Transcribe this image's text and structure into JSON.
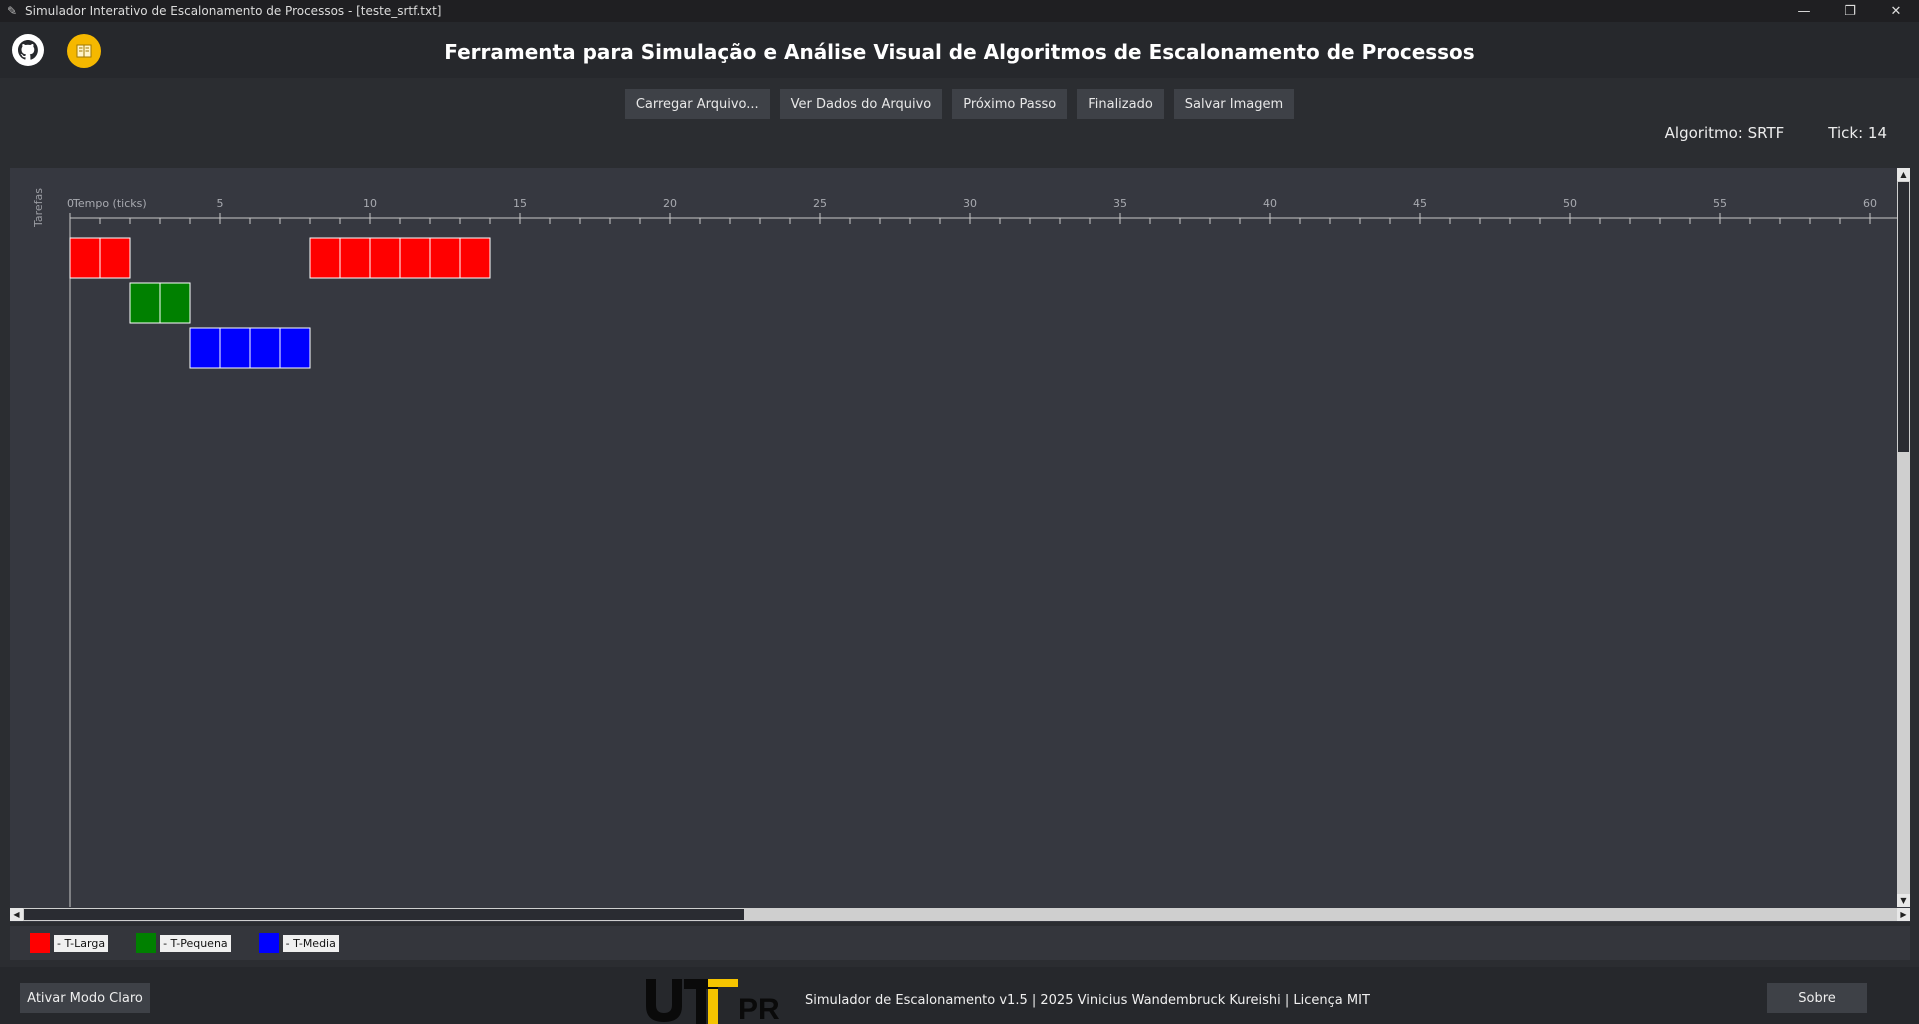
{
  "window": {
    "title": "Simulador Interativo de Escalonamento de Processos - [teste_srtf.txt]",
    "controls": [
      "—",
      "❐",
      "✕"
    ]
  },
  "header": {
    "title": "Ferramenta para Simulação e Análise Visual de Algoritmos de Escalonamento de Processos",
    "github_icon": "github-icon",
    "docs_icon": "book-icon"
  },
  "toolbar": {
    "load_label": "Carregar Arquivo...",
    "view_data_label": "Ver Dados do Arquivo",
    "next_step_label": "Próximo Passo",
    "finished_label": "Finalizado",
    "save_image_label": "Salvar Imagem"
  },
  "status": {
    "algorithm": "Algoritmo: SRTF",
    "tick": "Tick: 14"
  },
  "chart_data": {
    "type": "gantt",
    "xlabel": "Tempo (ticks)",
    "ylabel": "Tarefas",
    "x_ticks": [
      0,
      5,
      10,
      15,
      20,
      25,
      30,
      35,
      40,
      45,
      50,
      55,
      60
    ],
    "xlim": [
      0,
      61
    ],
    "series": [
      {
        "name": "T-Larga",
        "color": "#ff0000",
        "row": 0,
        "ticks": [
          0,
          1,
          8,
          9,
          10,
          11,
          12,
          13
        ]
      },
      {
        "name": "T-Pequena",
        "color": "#008000",
        "row": 1,
        "ticks": [
          2,
          3
        ]
      },
      {
        "name": "T-Media",
        "color": "#0000ff",
        "row": 2,
        "ticks": [
          4,
          5,
          6,
          7
        ]
      }
    ]
  },
  "legend": [
    {
      "label": "- T-Larga",
      "color": "#ff0000"
    },
    {
      "label": "- T-Pequena",
      "color": "#008000"
    },
    {
      "label": "- T-Media",
      "color": "#0000ff"
    }
  ],
  "footer": {
    "mode_label": "Ativar Modo Claro",
    "credit": "Simulador de Escalonamento v1.5 | 2025 Vinicius Wandembruck Kureishi | Licença MIT",
    "about_label": "Sobre",
    "logo_text": "UTFPR"
  }
}
